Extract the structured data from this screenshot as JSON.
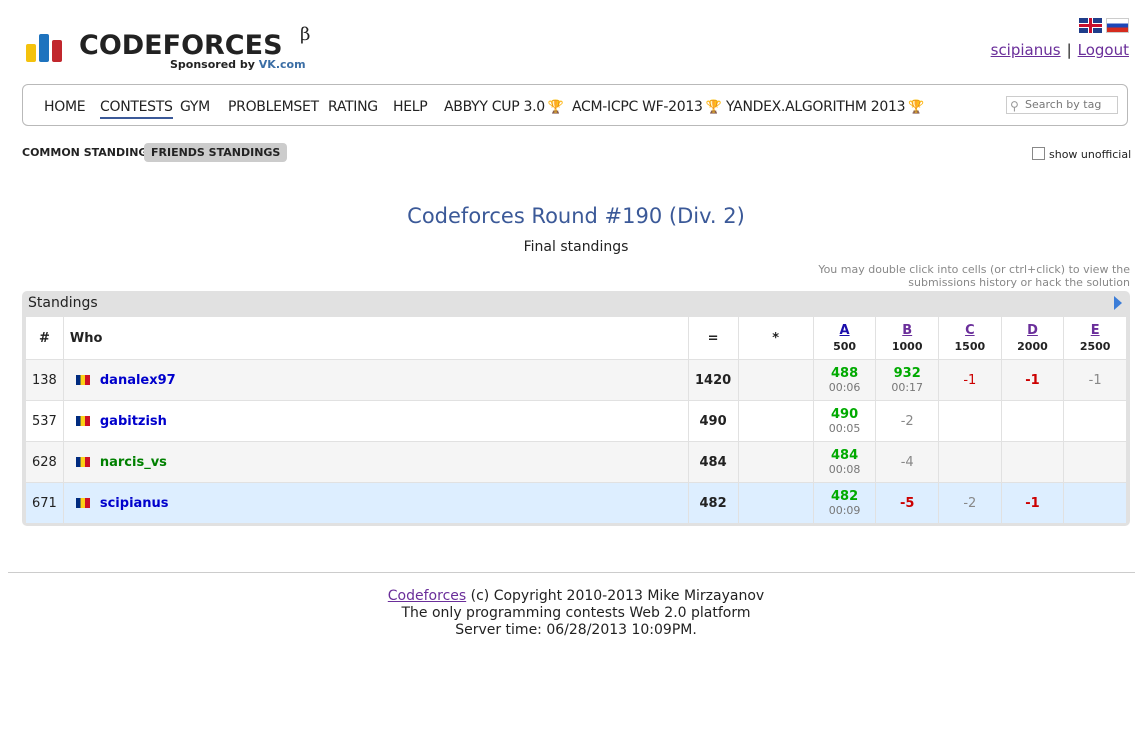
{
  "header": {
    "logo_text": "CODEFORCES",
    "beta": "β",
    "sponsor_prefix": "Sponsored by",
    "sponsor_name": "VK.com",
    "user": "scipianus",
    "logout": "Logout",
    "separator": "|",
    "logo_colors": [
      "#f4c20d",
      "#1e73be",
      "#c1272d"
    ]
  },
  "nav": {
    "items": [
      {
        "label": "HOME"
      },
      {
        "label": "CONTESTS"
      },
      {
        "label": "GYM"
      },
      {
        "label": "PROBLEMSET"
      },
      {
        "label": "RATING"
      },
      {
        "label": "HELP"
      },
      {
        "label": "ABBYY CUP 3.0"
      },
      {
        "label": "ACM-ICPC WF-2013"
      },
      {
        "label": "YANDEX.ALGORITHM 2013"
      }
    ],
    "search_placeholder": "Search by tag"
  },
  "tabs": {
    "common": "COMMON STANDINGS",
    "friends": "FRIENDS STANDINGS",
    "show_unofficial": "show unofficial"
  },
  "contest": {
    "title": "Codeforces Round #190 (Div. 2)",
    "subtitle": "Final standings",
    "hint_line1": "You may double click into cells (or ctrl+click) to view the",
    "hint_line2": "submissions history or hack the solution"
  },
  "standings": {
    "panel_title": "Standings",
    "columns": {
      "rank": "#",
      "who": "Who",
      "points": "=",
      "penalty": "*",
      "problems": [
        {
          "letter": "A",
          "points": "500"
        },
        {
          "letter": "B",
          "points": "1000"
        },
        {
          "letter": "C",
          "points": "1500"
        },
        {
          "letter": "D",
          "points": "2000"
        },
        {
          "letter": "E",
          "points": "2500"
        }
      ]
    },
    "rows": [
      {
        "rank": "138",
        "handle": "danalex97",
        "points": "1420",
        "penalty": "",
        "cells": [
          {
            "score": "488",
            "time": "00:06"
          },
          {
            "score": "932",
            "time": "00:17"
          },
          {
            "score": "-1"
          },
          {
            "score": "-1"
          },
          {
            "score": "-1"
          }
        ]
      },
      {
        "rank": "537",
        "handle": "gabitzish",
        "points": "490",
        "penalty": "",
        "cells": [
          {
            "score": "490",
            "time": "00:05"
          },
          {
            "score": "-2"
          },
          {
            "score": ""
          },
          {
            "score": ""
          },
          {
            "score": ""
          }
        ]
      },
      {
        "rank": "628",
        "handle": "narcis_vs",
        "points": "484",
        "penalty": "",
        "cells": [
          {
            "score": "484",
            "time": "00:08"
          },
          {
            "score": "-4"
          },
          {
            "score": ""
          },
          {
            "score": ""
          },
          {
            "score": ""
          }
        ]
      },
      {
        "rank": "671",
        "handle": "scipianus",
        "points": "482",
        "penalty": "",
        "cells": [
          {
            "score": "482",
            "time": "00:09"
          },
          {
            "score": "-5"
          },
          {
            "score": "-2"
          },
          {
            "score": "-1"
          },
          {
            "score": ""
          }
        ]
      }
    ]
  },
  "footer": {
    "link": "Codeforces",
    "copyright": "(c) Copyright 2010-2013 Mike Mirzayanov",
    "tagline": "The only programming contests Web 2.0 platform",
    "server_time": "Server time: 06/28/2013 10:09PM."
  }
}
